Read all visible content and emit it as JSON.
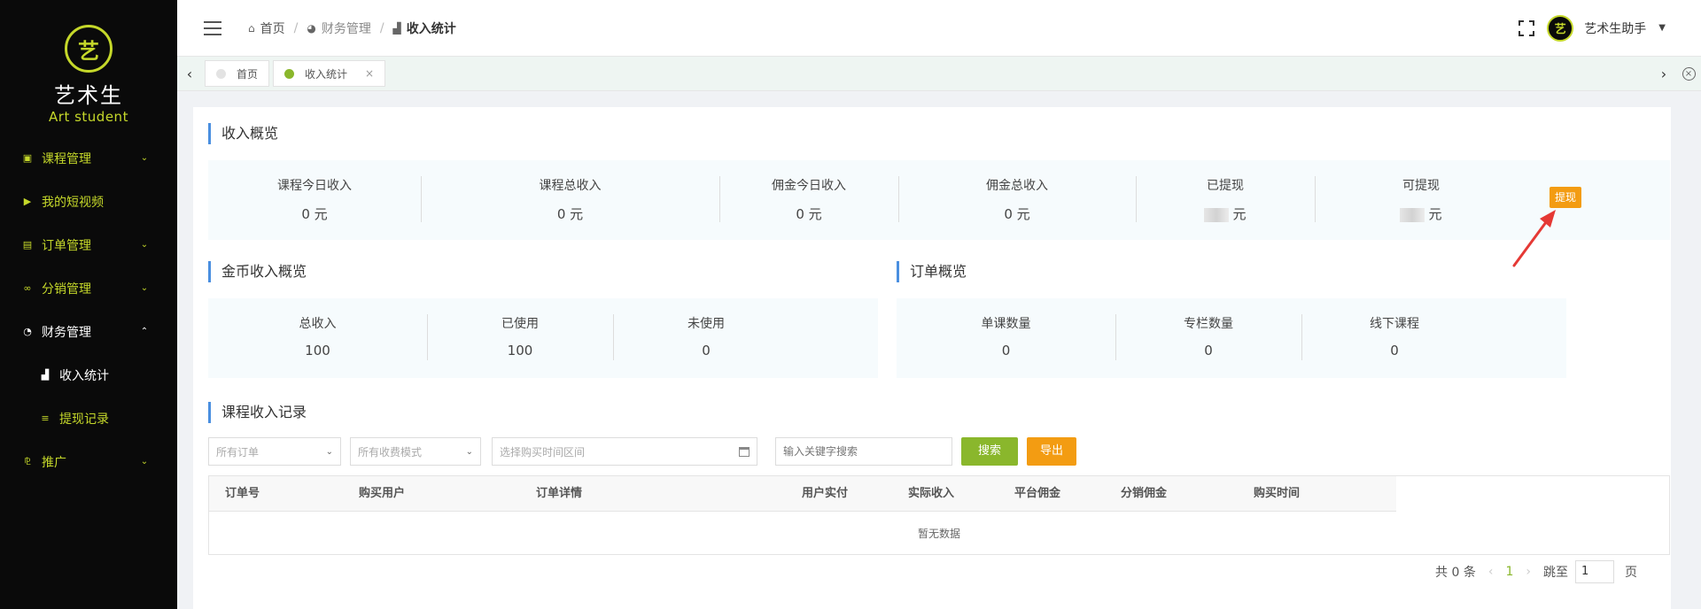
{
  "brand": {
    "logo_glyph": "艺",
    "title": "艺术生",
    "subtitle": "Art student"
  },
  "sidebar": {
    "items": [
      {
        "icon": "book-icon",
        "glyph": "▣",
        "label": "课程管理",
        "chevron": "⌄"
      },
      {
        "icon": "video-icon",
        "glyph": "▶",
        "label": "我的短视频"
      },
      {
        "icon": "order-icon",
        "glyph": "▤",
        "label": "订单管理",
        "chevron": "⌄"
      },
      {
        "icon": "share-icon",
        "glyph": "∞",
        "label": "分销管理",
        "chevron": "⌄"
      },
      {
        "icon": "finance-icon",
        "glyph": "◔",
        "label": "财务管理",
        "chevron": "⌃"
      },
      {
        "icon": "bar-chart-icon",
        "glyph": "▟",
        "label": "收入统计"
      },
      {
        "icon": "list-icon",
        "glyph": "≡",
        "label": "提现记录"
      },
      {
        "icon": "promote-icon",
        "glyph": "⅊",
        "label": "推广",
        "chevron": "⌄"
      }
    ]
  },
  "header": {
    "breadcrumb": [
      {
        "icon": "home-icon",
        "glyph": "⌂",
        "label": "首页"
      },
      {
        "icon": "pie-icon",
        "glyph": "◕",
        "label": "财务管理"
      },
      {
        "icon": "bar-chart-icon",
        "glyph": "▟",
        "label": "收入统计"
      }
    ],
    "separator": "/",
    "avatar_glyph": "艺",
    "user_name": "艺术生助手",
    "caret": "▼"
  },
  "tabs": {
    "left_arrow": "‹",
    "right_arrow": "›",
    "close_all": "×",
    "items": [
      {
        "label": "首页"
      },
      {
        "label": "收入统计",
        "close": "×"
      }
    ]
  },
  "income_overview": {
    "title": "收入概览",
    "stats": [
      {
        "label": "课程今日收入",
        "value": "0 元"
      },
      {
        "label": "课程总收入",
        "value": "0 元"
      },
      {
        "label": "佣金今日收入",
        "value": "0 元"
      },
      {
        "label": "佣金总收入",
        "value": "0 元"
      },
      {
        "label": "已提现",
        "value": "元"
      },
      {
        "label": "可提现",
        "value": "元"
      }
    ],
    "withdraw_button": "提现"
  },
  "coin_overview": {
    "title": "金币收入概览",
    "stats": [
      {
        "label": "总收入",
        "value": "100"
      },
      {
        "label": "已使用",
        "value": "100"
      },
      {
        "label": "未使用",
        "value": "0"
      }
    ]
  },
  "order_overview": {
    "title": "订单概览",
    "stats": [
      {
        "label": "单课数量",
        "value": "0"
      },
      {
        "label": "专栏数量",
        "value": "0"
      },
      {
        "label": "线下课程",
        "value": "0"
      }
    ]
  },
  "records": {
    "title": "课程收入记录",
    "filters": {
      "order_type": "所有订单",
      "pay_mode": "所有收费模式",
      "date_range": "选择购买时间区间",
      "keyword_placeholder": "输入关键字搜索",
      "dropdown_glyph": "⌄"
    },
    "search_button": "搜索",
    "export_button": "导出",
    "columns": [
      "订单号",
      "购买用户",
      "订单详情",
      "用户实付",
      "实际收入",
      "平台佣金",
      "分销佣金",
      "购买时间"
    ],
    "empty_text": "暂无数据"
  },
  "pagination": {
    "total": "共 0 条",
    "prev": "‹",
    "current": "1",
    "next": "›",
    "jump_label": "跳至",
    "jump_value": "1",
    "page_label": "页"
  },
  "colors": {
    "accent": "#8ab72c",
    "brand": "#c5d82a",
    "orange": "#f39c12",
    "title_bar": "#4a8fe0",
    "sidebar_bg": "#0a0a0a"
  }
}
